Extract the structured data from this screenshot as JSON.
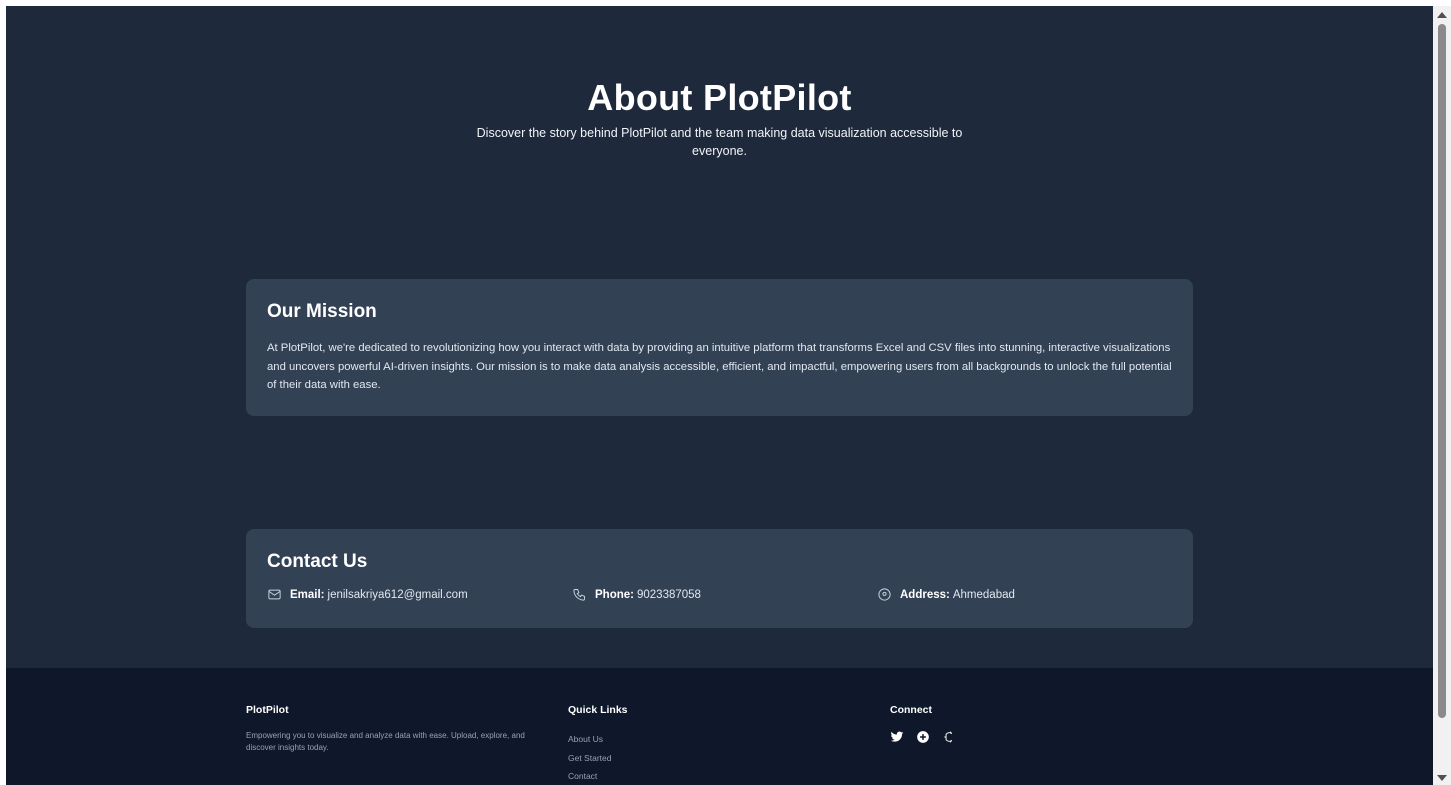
{
  "hero": {
    "title": "About PlotPilot",
    "subtitle": "Discover the story behind PlotPilot and the team making data visualization accessible to everyone."
  },
  "mission": {
    "heading": "Our Mission",
    "body": "At PlotPilot, we're dedicated to revolutionizing how you interact with data by providing an intuitive platform that transforms Excel and CSV files into stunning, interactive visualizations and uncovers powerful AI-driven insights. Our mission is to make data analysis accessible, efficient, and impactful, empowering users from all backgrounds to unlock the full potential of their data with ease."
  },
  "contact": {
    "heading": "Contact Us",
    "email_label": "Email:",
    "email_value": "jenilsakriya612@gmail.com",
    "phone_label": "Phone:",
    "phone_value": "9023387058",
    "address_label": "Address:",
    "address_value": "Ahmedabad",
    "icons": [
      "mail-icon",
      "phone-icon",
      "map-pin-icon"
    ]
  },
  "footer": {
    "brand": "PlotPilot",
    "tagline": "Empowering you to visualize and analyze data with ease. Upload, explore, and discover insights today.",
    "quick_links_heading": "Quick Links",
    "quick_links": [
      "About Us",
      "Get Started",
      "Contact"
    ],
    "connect_heading": "Connect",
    "social_icons": [
      "twitter-icon",
      "plus-circle-icon",
      "threads-icon"
    ]
  },
  "colors": {
    "page_bg": "#1e293b",
    "card_bg": "#334155",
    "footer_bg": "#0f172a"
  }
}
